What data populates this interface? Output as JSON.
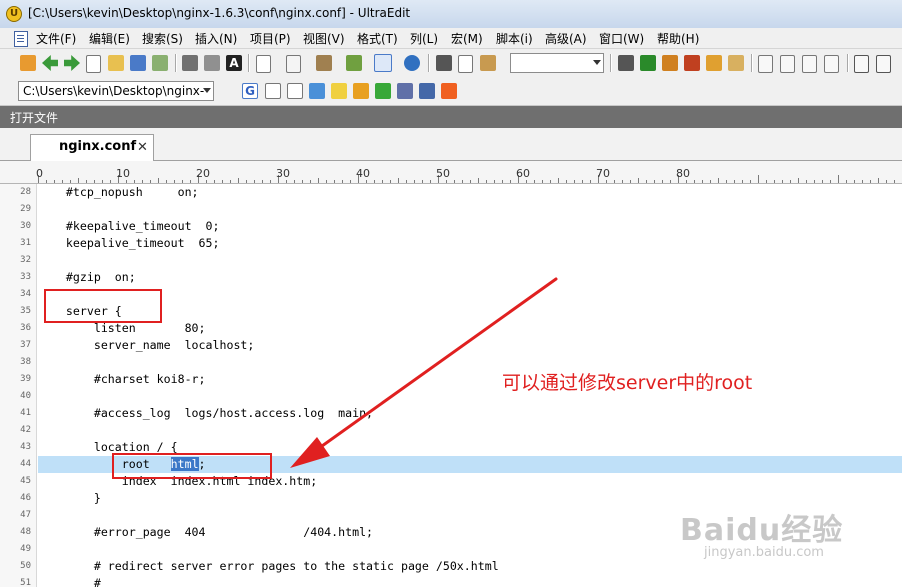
{
  "window": {
    "title": "[C:\\Users\\kevin\\Desktop\\nginx-1.6.3\\conf\\nginx.conf] - UltraEdit"
  },
  "menu": [
    "文件(F)",
    "编辑(E)",
    "搜索(S)",
    "插入(N)",
    "项目(P)",
    "视图(V)",
    "格式(T)",
    "列(L)",
    "宏(M)",
    "脚本(i)",
    "高级(A)",
    "窗口(W)",
    "帮助(H)"
  ],
  "toolbar2": {
    "path_combo": "C:\\Users\\kevin\\Desktop\\nginx-"
  },
  "panel": {
    "open_files_label": "打开文件"
  },
  "tabs": [
    {
      "label": "nginx.conf",
      "close": "✕"
    }
  ],
  "ruler": {
    "labels": [
      "0",
      "10",
      "20",
      "30",
      "40",
      "50",
      "60",
      "70",
      "80"
    ]
  },
  "code_lines": [
    {
      "num": "28",
      "text": "    #tcp_nopush     on;"
    },
    {
      "num": "29",
      "text": ""
    },
    {
      "num": "30",
      "text": "    #keepalive_timeout  0;"
    },
    {
      "num": "31",
      "text": "    keepalive_timeout  65;"
    },
    {
      "num": "32",
      "text": ""
    },
    {
      "num": "33",
      "text": "    #gzip  on;"
    },
    {
      "num": "34",
      "text": ""
    },
    {
      "num": "35",
      "text": "    server {"
    },
    {
      "num": "36",
      "text": "        listen       80;"
    },
    {
      "num": "37",
      "text": "        server_name  localhost;"
    },
    {
      "num": "38",
      "text": ""
    },
    {
      "num": "39",
      "text": "        #charset koi8-r;"
    },
    {
      "num": "40",
      "text": ""
    },
    {
      "num": "41",
      "text": "        #access_log  logs/host.access.log  main;"
    },
    {
      "num": "42",
      "text": ""
    },
    {
      "num": "43",
      "text": "        location / {"
    },
    {
      "num": "44",
      "pre": "            root   ",
      "sel": "html",
      "post": ";"
    },
    {
      "num": "45",
      "text": "            index  index.html index.htm;"
    },
    {
      "num": "46",
      "text": "        }"
    },
    {
      "num": "47",
      "text": ""
    },
    {
      "num": "48",
      "text": "        #error_page  404              /404.html;"
    },
    {
      "num": "49",
      "text": ""
    },
    {
      "num": "50",
      "text": "        # redirect server error pages to the static page /50x.html"
    },
    {
      "num": "51",
      "text": "        #"
    }
  ],
  "annotation": {
    "text": "可以通过修改server中的root",
    "color": "#e02020"
  },
  "watermark": {
    "text": "Baidu经验",
    "sub": "jingyan.baidu.com"
  },
  "colors": {
    "highlight_line": "#bfe0f8",
    "selection": "#3c78c8",
    "open_files_bar": "#6f6f6f"
  }
}
